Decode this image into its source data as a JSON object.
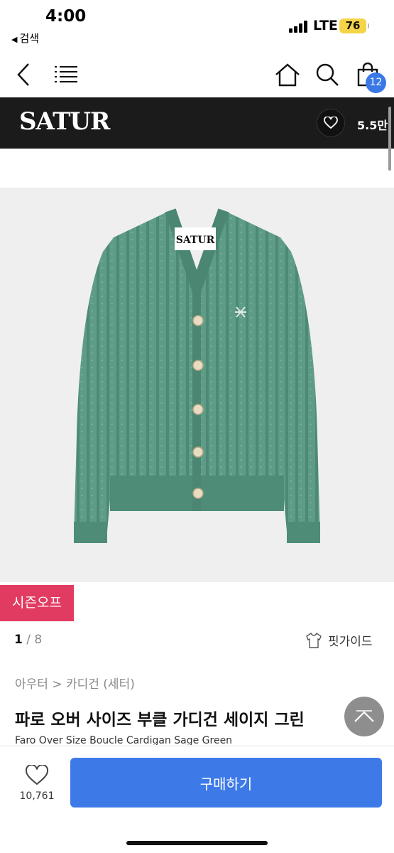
{
  "status_bar": {
    "time": "4:00",
    "back_app": "검색",
    "network": "LTE",
    "battery": "76"
  },
  "nav": {
    "cart_count": "12"
  },
  "brand": {
    "name": "SATUR",
    "like_count": "5.5만"
  },
  "product": {
    "image_label": "SATUR",
    "season_badge": "시즌오프",
    "pager_current": "1",
    "pager_rest": " / 8",
    "fit_guide": "핏가이드",
    "breadcrumb": "아우터 > 카디건 (세터)",
    "title_ko": "파로 오버 사이즈 부클 가디건 세이지 그린",
    "title_en": "Faro Over Size Boucle Cardigan Sage Green"
  },
  "bottom": {
    "wish_count": "10,761",
    "buy_label": "구매하기"
  },
  "colors": {
    "accent": "#3d7ae8",
    "badge": "#e23b62",
    "cardigan": "#5c9a86",
    "brand_bar": "#1b1b1b"
  }
}
